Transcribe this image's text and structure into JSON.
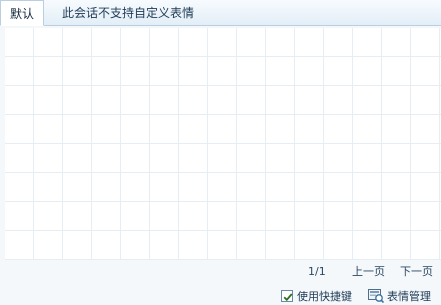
{
  "tabs": [
    {
      "label": "默认",
      "active": true
    },
    {
      "label": "此会话不支持自定义表情",
      "active": false
    }
  ],
  "pager": {
    "indicator": "1/1",
    "prev_label": "上一页",
    "next_label": "下一页"
  },
  "footer": {
    "shortcut_label": "使用快捷键",
    "shortcut_checked": true,
    "manage_label": "表情管理",
    "manage_icon": "emoticon-manage-icon"
  },
  "colors": {
    "accent": "#2a6f1e",
    "grid_line": "#e6edf3",
    "panel_bg": "#f4f8fb",
    "tab_border": "#b9cfe1"
  }
}
